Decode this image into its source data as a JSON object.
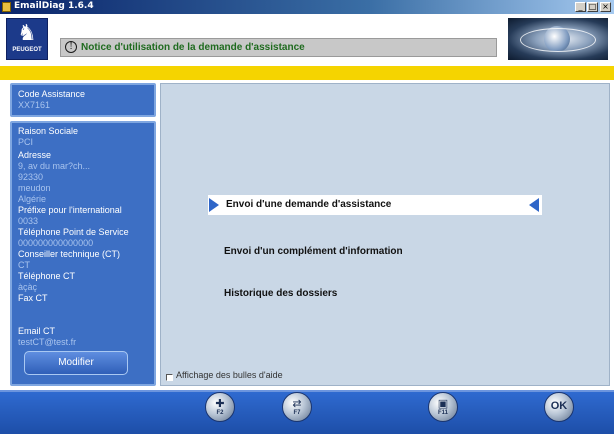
{
  "window": {
    "title": "EmailDiag  1.6.4",
    "buttons": [
      "_",
      "□",
      "×"
    ]
  },
  "header": {
    "brand": "PEUGEOT",
    "notice_icon": "info-circle-icon",
    "notice_text": "Notice d'utilisation de la demande d'assistance"
  },
  "sidebar": {
    "code_assistance_label": "Code Assistance",
    "code_assistance_value": "XX7161",
    "raison_sociale_label": "Raison Sociale",
    "raison_sociale_value": "PCI",
    "adresse_label": "Adresse",
    "adresse_line1": "9, av du mar?ch...",
    "adresse_line2": "92330",
    "adresse_line3": "meudon",
    "adresse_line4": "Algérie",
    "prefixe_label": "Préfixe pour l'international",
    "prefixe_value": "0033",
    "tel_point_label": "Téléphone Point de Service",
    "tel_point_value": "000000000000000",
    "conseiller_label": "Conseiller technique (CT)",
    "conseiller_value": "CT",
    "tel_ct_label": "Téléphone CT",
    "tel_ct_value": "àçàç",
    "fax_ct_label": "Fax CT",
    "fax_ct_value": "",
    "email_ct_label": "Email CT",
    "email_ct_value": "testCT@test.fr",
    "modifier_label": "Modifier"
  },
  "main": {
    "menu": [
      {
        "label": "Envoi d'une demande d'assistance",
        "selected": true
      },
      {
        "label": "Envoi d'un complément d'information",
        "selected": false
      },
      {
        "label": "Historique des dossiers",
        "selected": false
      }
    ],
    "help_checkbox_label": "Affichage des bulles d'aide",
    "help_checkbox_checked": false
  },
  "toolbar": {
    "buttons": [
      {
        "icon": "add-page-icon",
        "key": "F2"
      },
      {
        "icon": "transfer-icon",
        "key": "F7"
      },
      {
        "icon": "computer-icon",
        "key": "F11"
      },
      {
        "icon": "ok-icon",
        "key": "OK"
      }
    ]
  },
  "colors": {
    "accent_yellow": "#f5d400",
    "panel_blue": "#3d6fc4",
    "main_bg": "#c9d7e6",
    "arrow_blue": "#2f66c8"
  }
}
